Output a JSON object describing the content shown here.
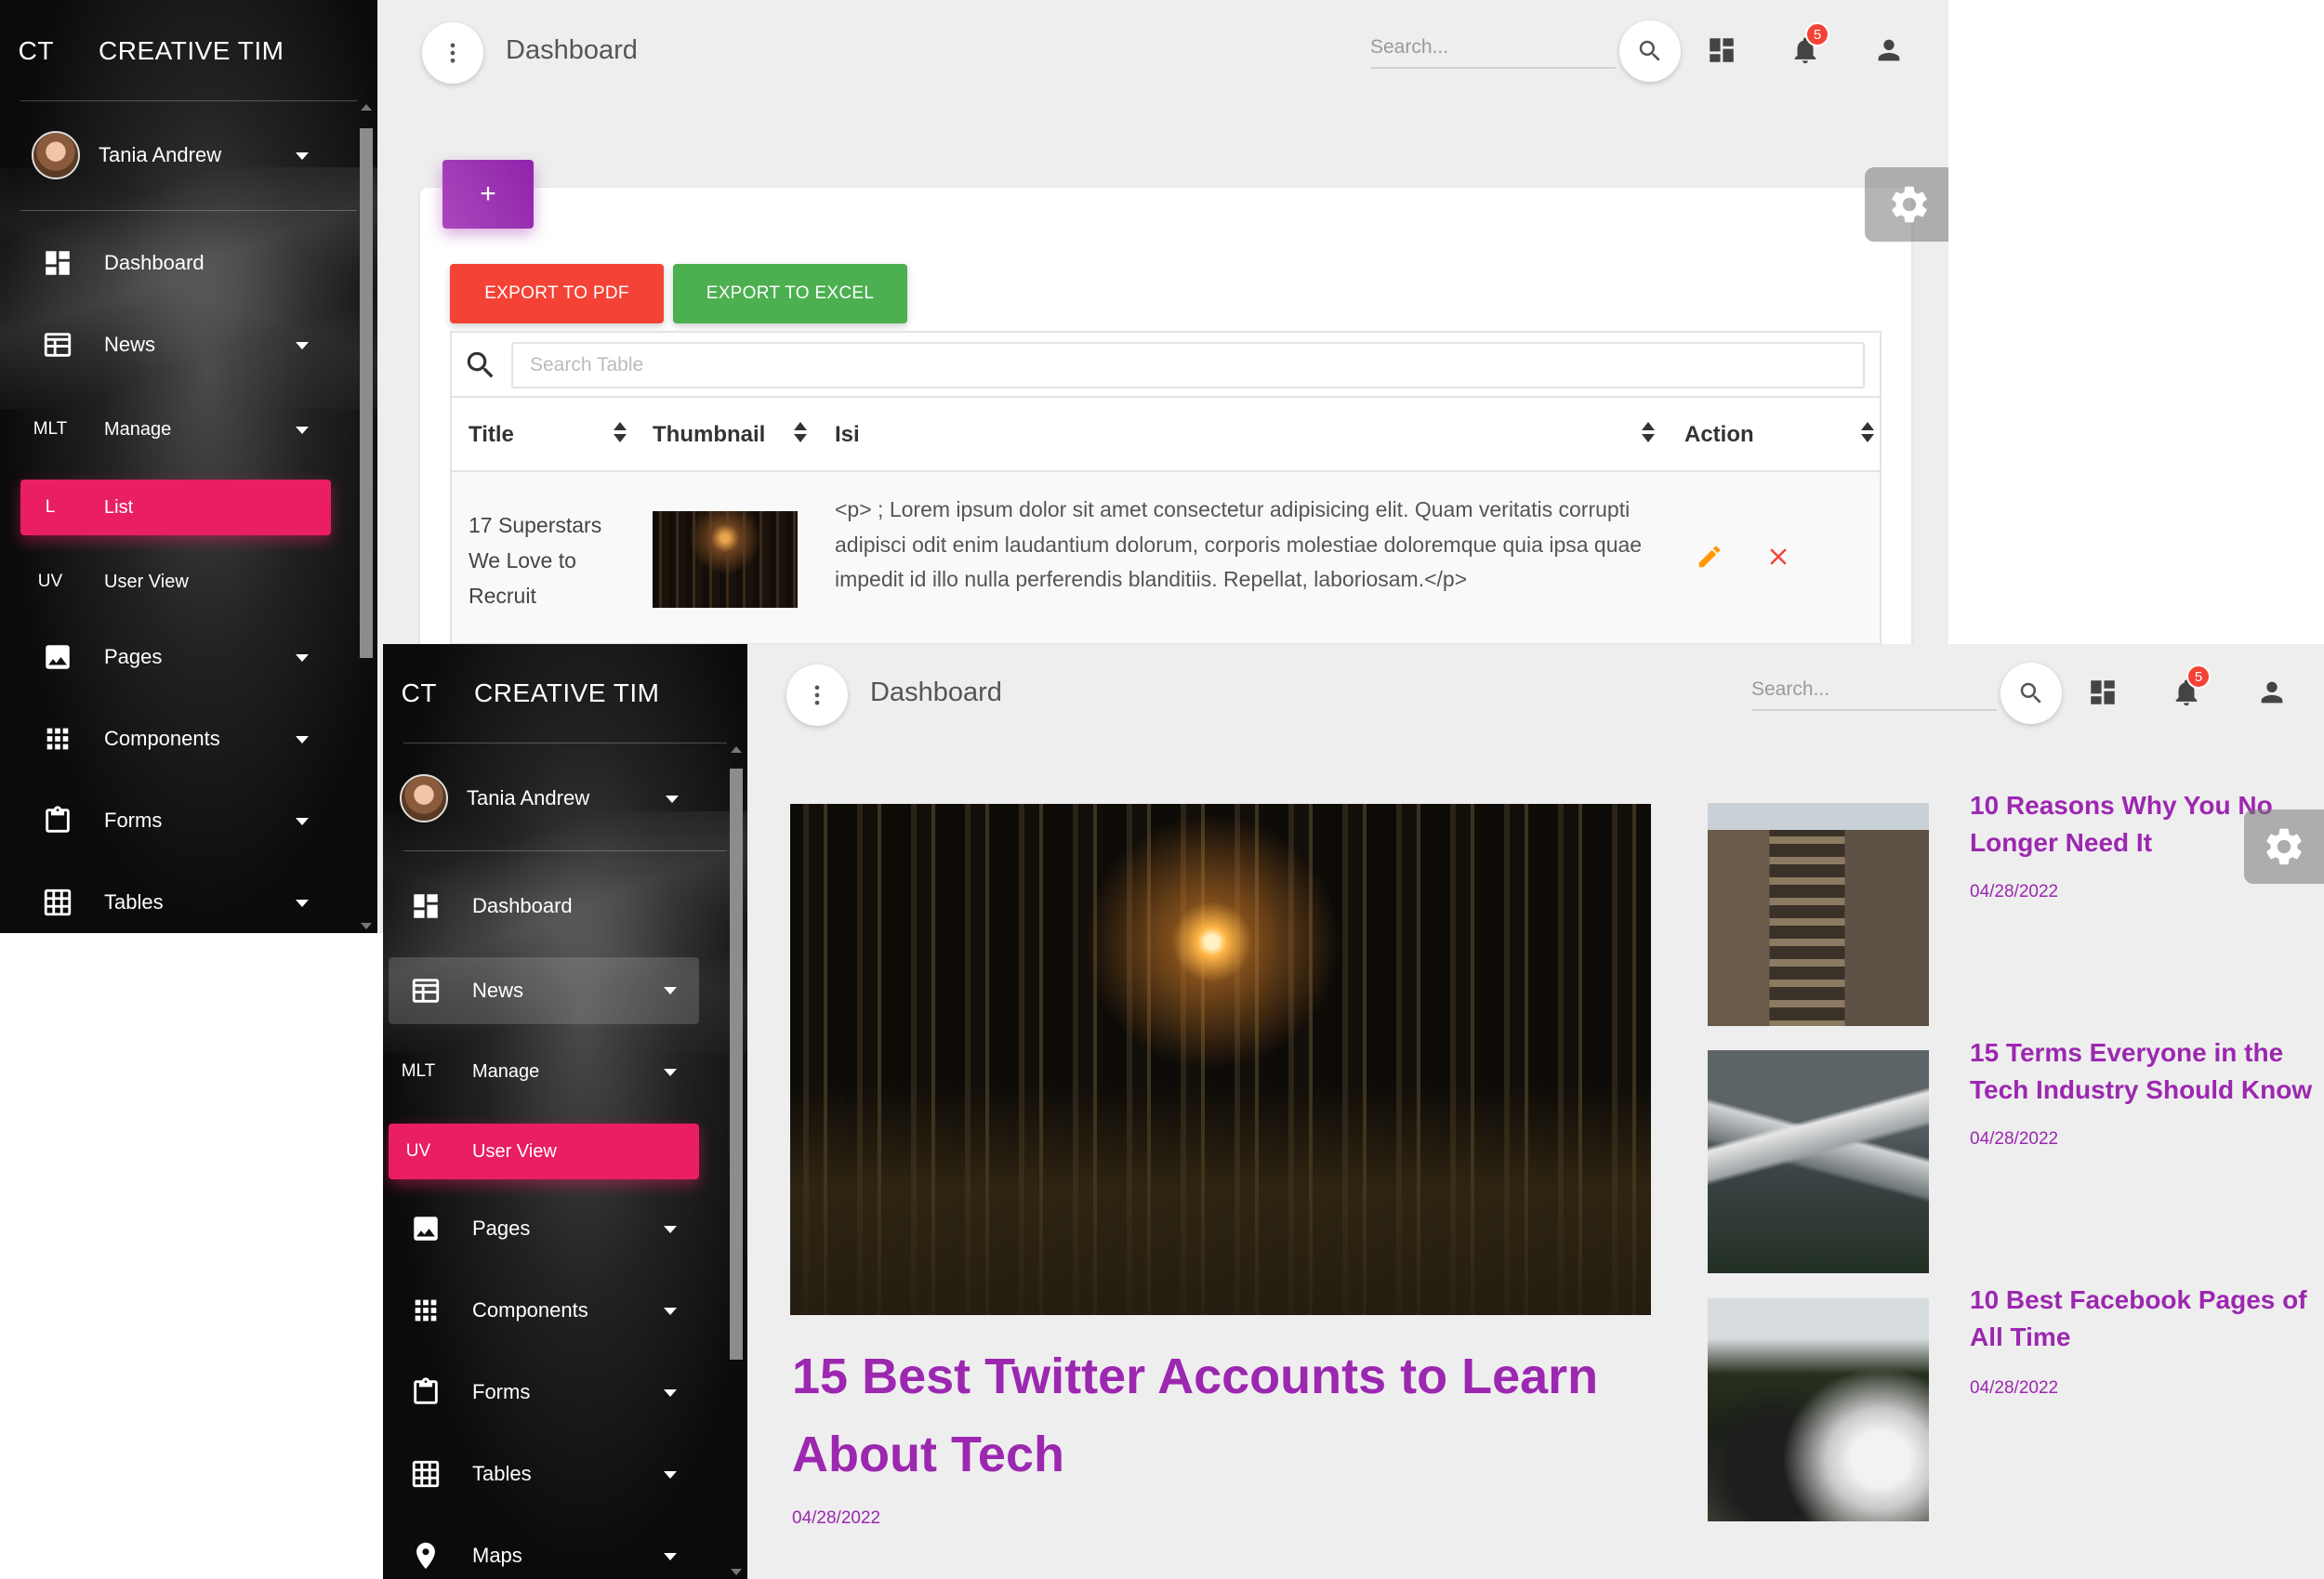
{
  "screen1": {
    "sidebar": {
      "logo_mini": "CT",
      "logo_text": "CREATIVE TIM",
      "user_name": "Tania Andrew",
      "items": [
        {
          "mini": "",
          "label": "Dashboard",
          "icon": "dashboard-icon"
        },
        {
          "mini": "",
          "label": "News",
          "icon": "news-icon"
        },
        {
          "mini": "MLT",
          "label": "Manage",
          "icon": ""
        },
        {
          "mini": "L",
          "label": "List",
          "icon": ""
        },
        {
          "mini": "UV",
          "label": "User View",
          "icon": ""
        },
        {
          "mini": "",
          "label": "Pages",
          "icon": "image-icon"
        },
        {
          "mini": "",
          "label": "Components",
          "icon": "apps-icon"
        },
        {
          "mini": "",
          "label": "Forms",
          "icon": "clipboard-icon"
        },
        {
          "mini": "",
          "label": "Tables",
          "icon": "grid-icon"
        }
      ]
    },
    "topbar": {
      "brand": "Dashboard",
      "search_placeholder": "Search...",
      "notifications": "5"
    },
    "toolbar": {
      "add_label": "+",
      "export_pdf": "EXPORT TO PDF",
      "export_excel": "EXPORT TO EXCEL"
    },
    "table": {
      "search_placeholder": "Search Table",
      "columns": [
        "Title",
        "Thumbnail",
        "Isi",
        "Action"
      ],
      "rows": [
        {
          "title": "17 Superstars We Love to Recruit",
          "isi": "<p> ; Lorem ipsum dolor sit amet consectetur adipisicing elit. Quam veritatis corrupti adipisci odit enim laudantium dolorum, corporis molestiae doloremque quia ipsa quae impedit id illo nulla perferendis blanditiis. Repellat, laboriosam.</p>"
        }
      ]
    }
  },
  "screen2": {
    "sidebar": {
      "logo_mini": "CT",
      "logo_text": "CREATIVE TIM",
      "user_name": "Tania Andrew",
      "items": [
        {
          "mini": "",
          "label": "Dashboard"
        },
        {
          "mini": "",
          "label": "News"
        },
        {
          "mini": "MLT",
          "label": "Manage"
        },
        {
          "mini": "UV",
          "label": "User View"
        },
        {
          "mini": "",
          "label": "Pages"
        },
        {
          "mini": "",
          "label": "Components"
        },
        {
          "mini": "",
          "label": "Forms"
        },
        {
          "mini": "",
          "label": "Tables"
        },
        {
          "mini": "",
          "label": "Maps"
        }
      ]
    },
    "topbar": {
      "brand": "Dashboard",
      "search_placeholder": "Search...",
      "notifications": "5"
    },
    "featured": {
      "title": "15 Best Twitter Accounts to Learn About Tech",
      "date": "04/28/2022"
    },
    "articles": [
      {
        "title": "10 Reasons Why You No Longer Need It",
        "date": "04/28/2022"
      },
      {
        "title": "15 Terms Everyone in the Tech Industry Should Know",
        "date": "04/28/2022"
      },
      {
        "title": "10 Best Facebook Pages of All Time",
        "date": "04/28/2022"
      }
    ]
  },
  "colors": {
    "primary": "#9c27b0",
    "active_pink": "#e91e63",
    "danger": "#f44336",
    "success": "#4caf50",
    "warning": "#ff9800"
  }
}
